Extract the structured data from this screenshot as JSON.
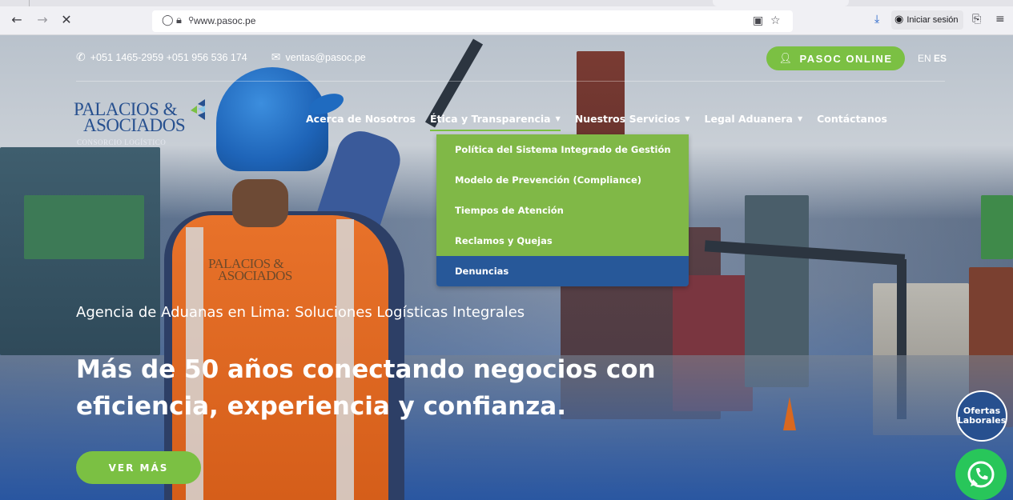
{
  "browser": {
    "url": "www.pasoc.pe",
    "signin_label": "Iniciar sesión"
  },
  "topbar": {
    "phone": "+051 1465-2959  +051 956 536 174",
    "email": "ventas@pasoc.pe",
    "pasoc_online_label": "PASOC ONLINE",
    "lang_en": "EN",
    "lang_es": "ES"
  },
  "logo": {
    "line1": "PALACIOS &",
    "line2": "ASOCIADOS",
    "line3": "CONSORCIO LOGÍSTICO",
    "vest_line1": "PALACIOS &",
    "vest_line2": "ASOCIADOS"
  },
  "nav": {
    "items": [
      {
        "label": "Acerca de Nosotros"
      },
      {
        "label": "Ética y Transparencia"
      },
      {
        "label": "Nuestros Servicios"
      },
      {
        "label": "Legal Aduanera"
      },
      {
        "label": "Contáctanos"
      }
    ]
  },
  "dropdown": {
    "items": [
      {
        "label": "Política del Sistema Integrado de Gestión"
      },
      {
        "label": "Modelo de Prevención (Compliance)"
      },
      {
        "label": "Tiempos de Atención"
      },
      {
        "label": "Reclamos y Quejas"
      },
      {
        "label": "Denuncias"
      }
    ]
  },
  "hero": {
    "subtitle": "Agencia de Aduanas en Lima: Soluciones Logísticas Integrales",
    "title_line1": "Más de 50 años conectando negocios con",
    "title_line2": "eficiencia, experiencia y confianza.",
    "cta_label": "VER MÁS"
  },
  "floating": {
    "ofertas_line1": "Ofertas",
    "ofertas_line2": "Laborales"
  },
  "colors": {
    "brand_green": "#7bc043",
    "brand_blue": "#27508f",
    "dropdown_hover": "#275899",
    "whatsapp_green": "#28c65a"
  }
}
